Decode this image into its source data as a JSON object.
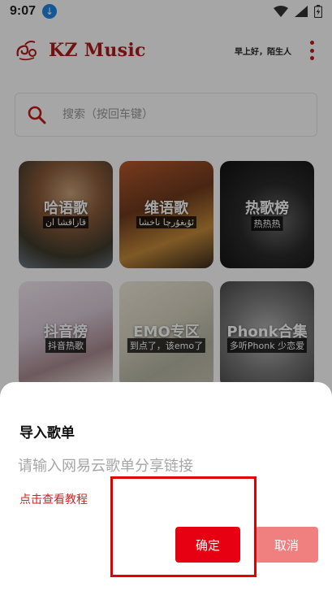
{
  "status_bar": {
    "time": "9:07"
  },
  "header": {
    "app_title": "KZ Music",
    "greeting": "早上好，陌生人",
    "brand_color": "#b11a1a"
  },
  "search": {
    "placeholder": "搜索（按回车键）"
  },
  "tiles": [
    {
      "title": "哈语歌",
      "subtitle": "قازاقشا ان"
    },
    {
      "title": "维语歌",
      "subtitle": "ئۇيغۇرچا ناخشا"
    },
    {
      "title": "热歌榜",
      "subtitle": "热热热"
    },
    {
      "title": "抖音榜",
      "subtitle": "抖音热歌"
    },
    {
      "title": "EMO专区",
      "subtitle": "到点了，该emo了"
    },
    {
      "title": "Phonk合集",
      "subtitle": "多听Phonk 少恋爱"
    }
  ],
  "dialog": {
    "title": "导入歌单",
    "input_placeholder": "请输入网易云歌单分享链接",
    "tutorial_link": "点击查看教程",
    "confirm_label": "确定",
    "cancel_label": "取消",
    "confirm_color": "#e60012",
    "cancel_color": "#f08080"
  },
  "icons": [
    "download-icon",
    "wifi-icon",
    "signal-icon",
    "battery-icon",
    "search-icon",
    "more-vert-icon",
    "logo-icon"
  ]
}
